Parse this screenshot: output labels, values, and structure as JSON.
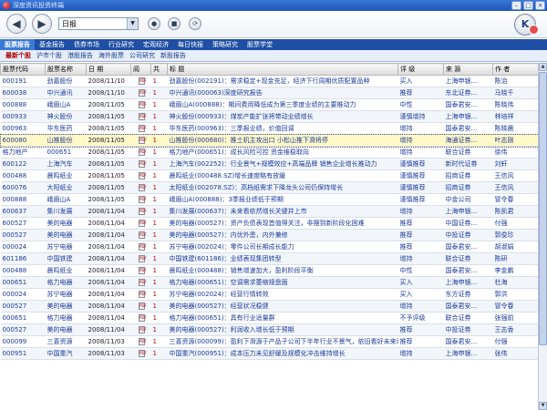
{
  "window": {
    "title": "深度资讯投资终端"
  },
  "toolbar": {
    "period_value": "日报",
    "dropdown_arrow": "▼",
    "back_glyph": "◀",
    "forward_glyph": "▶",
    "go_glyph": "●",
    "stop_glyph": "■",
    "refresh_glyph": "⟳",
    "brand_glyph": "K"
  },
  "tabs": [
    "股票报告",
    "基金报告",
    "债券市场",
    "行业研究",
    "宏观经济",
    "每日快报",
    "策略研究",
    "股票学堂"
  ],
  "subtabs": [
    "最新个股",
    "沪市个股",
    "港股报告",
    "海外股票",
    "公司研究",
    "新股报告"
  ],
  "table": {
    "headers": [
      "股票代码",
      "股票名称",
      "日 期",
      "阅",
      "共",
      "标 题",
      "评 级",
      "来 源",
      "作 者"
    ],
    "rows": [
      [
        "000191",
        "劲嘉股份",
        "2008/11/10",
        "",
        "1",
        "劲嘉股份(002191)：需求稳定+现金充足，经济下行周期优质配置品种",
        "买入",
        "上海申银...",
        "陈治"
      ],
      [
        "600038",
        "中兴通讯",
        "2008/11/10",
        "",
        "1",
        "中兴通讯(000063)深度研究报告",
        "推荐",
        "东北证券...",
        "马晓千"
      ],
      [
        "000888",
        "峨眉山A",
        "2008/11/05",
        "",
        "1",
        "峨眉山A(000888)：期间费用降低成为第三季度业绩的主要推动力",
        "中性",
        "国泰君安...",
        "陈晓伟"
      ],
      [
        "000933",
        "神火股份",
        "2008/11/05",
        "",
        "1",
        "神火股份(000933)：煤炭产能扩张将带动业绩增长",
        "谨慎增持",
        "上海申银...",
        "林培祥"
      ],
      [
        "000963",
        "华东医药",
        "2008/11/05",
        "",
        "1",
        "华东医药(000963)：三季报业绩，价值回调",
        "增持",
        "国泰君安...",
        "陈晓晨"
      ],
      [
        "600080",
        "山推股份",
        "2008/11/05",
        "",
        "1",
        "山推股份(000680)：推土机主攻出口 小松山推下滑将停",
        "增持",
        "海通证券...",
        "叶志刚"
      ],
      [
        "格力地产",
        "000651",
        "2008/11/05",
        "",
        "1",
        "格力地产(000651)：成长风险可控 资金维稳取向",
        "增持",
        "联合证券",
        "徐伟"
      ],
      [
        "600122",
        "上海汽车",
        "2008/11/05",
        "",
        "1",
        "上海汽车(002252)：行业景气+规模效应+高端品牌 销售企业增长推动力",
        "谨慎推荐",
        "新时代证券",
        "刘轩"
      ],
      [
        "000488",
        "晨鸣纸业",
        "2008/11/05",
        "",
        "1",
        "晨鸣纸业(000488.SZ)增长速度略有放缓",
        "谨慎推荐",
        "招商证券",
        "王信风"
      ],
      [
        "600076",
        "大阳纸业",
        "2008/11/05",
        "",
        "1",
        "太阳纸业(002078.SZ)：高档纸需求下降龙头公司仍保持增长",
        "谨慎推荐",
        "招商证券",
        "王信风"
      ],
      [
        "000888",
        "峨眉山A",
        "2008/11/05",
        "",
        "1",
        "峨眉山A(000888)：3季报业绩低于预期",
        "谨慎推荐",
        "中金公司",
        "冒令春"
      ],
      [
        "600637",
        "集川发展",
        "2008/11/04",
        "",
        "1",
        "集川发展(000637)：未来看依然增长关键并上市",
        "增持",
        "上海申银...",
        "陈凯君"
      ],
      [
        "600527",
        "美的电器",
        "2008/11/04",
        "",
        "1",
        "美的电器(000527)：资产负债表现首值得关注，非摆到新阶段化困难",
        "推荐",
        "中国证券...",
        "付强"
      ],
      [
        "000527",
        "美的电器",
        "2008/11/04",
        "",
        "1",
        "美的电器(000527)：内优外患，内外兼修",
        "推荐",
        "中投证券",
        "郭俊珍"
      ],
      [
        "000024",
        "苏宁电器",
        "2008/11/04",
        "",
        "1",
        "苏宁电器(002024)：零件公司长期成长能力",
        "推荐",
        "国泰君安...",
        "胡淑娟"
      ],
      [
        "601186",
        "中国铁建",
        "2008/11/04",
        "",
        "1",
        "中国铁建(601186)：业绩表现集团转型",
        "增持",
        "联合证券",
        "陈研"
      ],
      [
        "000488",
        "晨鸣纸业",
        "2008/11/04",
        "",
        "1",
        "晨鸣纸业(000488)：销售增速加大，盈利阶段平衡",
        "中性",
        "国泰君安...",
        "李金鹏"
      ],
      [
        "000651",
        "格力电器",
        "2008/11/04",
        "",
        "1",
        "格力电器(000651)：空调需求萎缩规盘面",
        "买入",
        "上海申银...",
        "杜海"
      ],
      [
        "000024",
        "苏宁电器",
        "2008/11/04",
        "",
        "1",
        "苏宁电器(002024)：经营行情转效",
        "买入",
        "东方证券",
        "郭洪"
      ],
      [
        "000527",
        "美的电器",
        "2008/11/04",
        "",
        "1",
        "美的电器(000527)：经营状况稳健",
        "增持",
        "国泰君安...",
        "冒令春"
      ],
      [
        "000651",
        "格力电器",
        "2008/11/04",
        "",
        "1",
        "格力电器(000651)：具有行业适量群",
        "不予评级",
        "联合证券",
        "张强前"
      ],
      [
        "000527",
        "美的电器",
        "2008/11/04",
        "",
        "1",
        "美的电器(000527)：利润收入增长低于预期",
        "推荐",
        "中投证券",
        "王志香"
      ],
      [
        "000099",
        "三喜资源",
        "2008/11/03",
        "",
        "1",
        "三喜资源(000099)：盈利下滑源于产品子公司下半年行业不景气，依旧看好未来增长前景",
        "推荐",
        "国泰君安...",
        "付强"
      ],
      [
        "000951",
        "中国重汽",
        "2008/11/03",
        "",
        "1",
        "中国重汽(000951)：成本压力未见舒缓及规模化冲击维持增长",
        "增持",
        "上海申银...",
        "张伟"
      ]
    ]
  }
}
